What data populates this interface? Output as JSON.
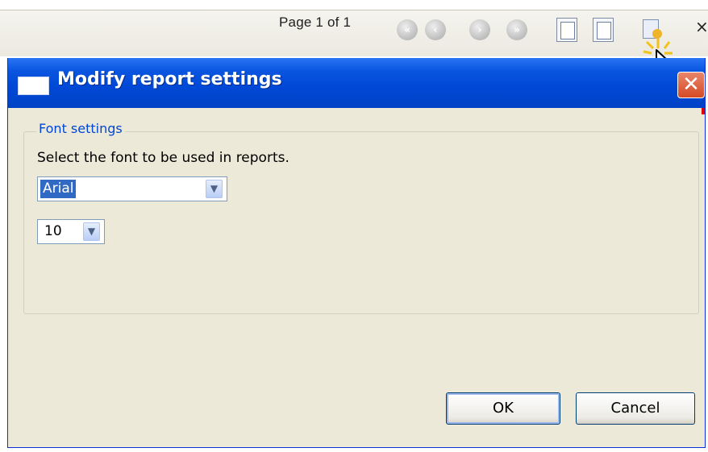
{
  "toolbar": {
    "page_label": "Page 1 of 1",
    "close_glyph": "×",
    "nav_buttons": [
      {
        "icon": "first-page-icon",
        "glyph": "«"
      },
      {
        "icon": "previous-page-icon",
        "glyph": "‹"
      },
      {
        "icon": "next-page-icon",
        "glyph": "›"
      },
      {
        "icon": "last-page-icon",
        "glyph": "»"
      }
    ],
    "page_view_buttons": [
      {
        "icon": "single-page-icon"
      },
      {
        "icon": "page-width-icon"
      }
    ],
    "settings_icon": "report-settings-icon"
  },
  "dialog": {
    "title": "Modify report settings",
    "close_glyph": "✕",
    "group_title": "Font settings",
    "description": "Select the font to be used in reports.",
    "font_select": {
      "value": "Arial"
    },
    "size_select": {
      "value": "10"
    },
    "ok_label": "OK",
    "cancel_label": "Cancel"
  },
  "colors": {
    "title_bar": "#0049d7",
    "dialog_face": "#ece9d8",
    "group_title": "#0046d5",
    "selection": "#316ac5",
    "close_button": "#d44a25"
  }
}
